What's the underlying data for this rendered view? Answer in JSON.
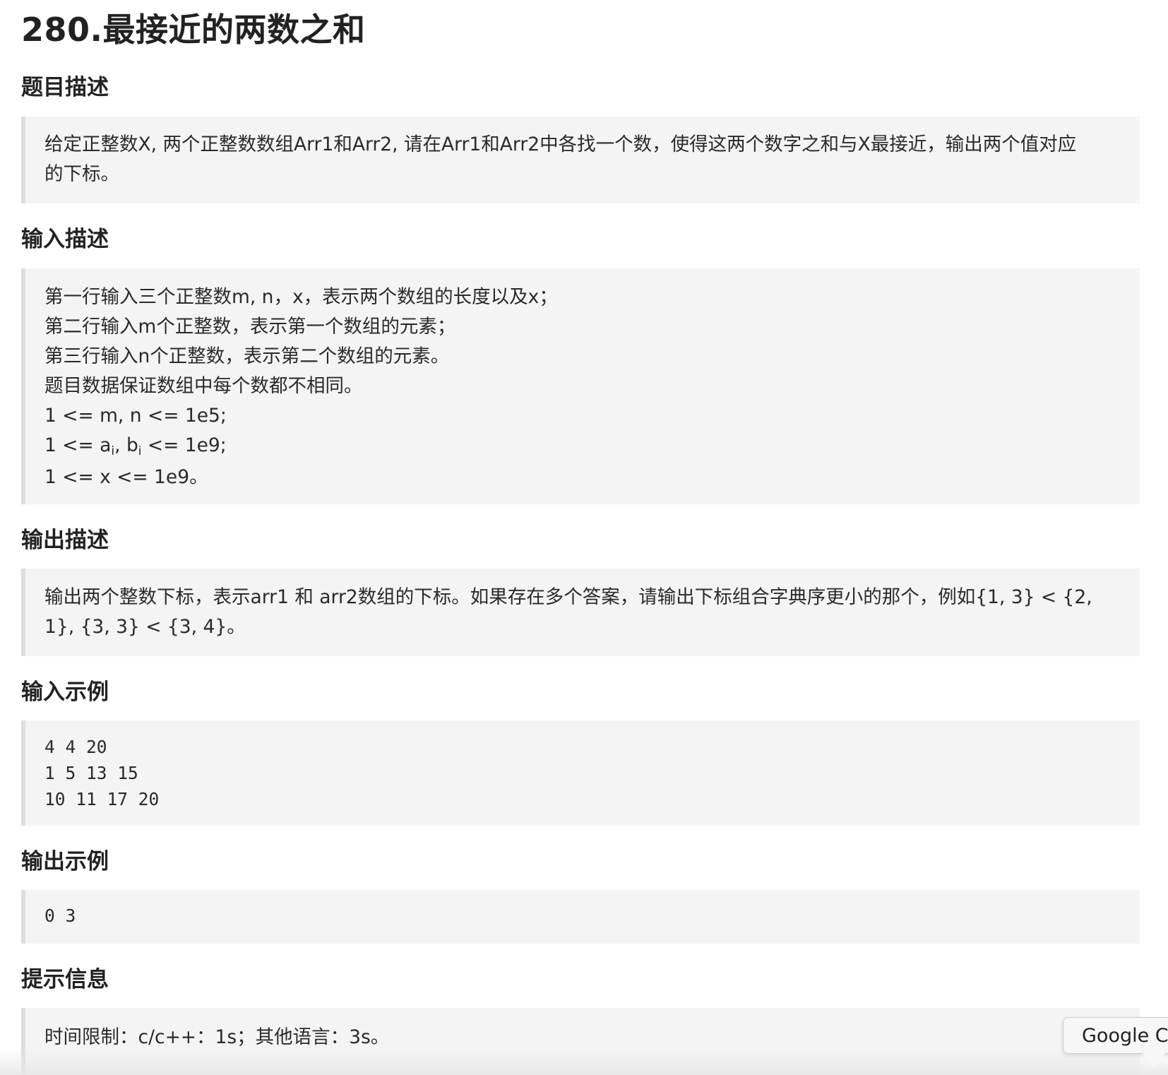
{
  "title": "280.最接近的两数之和",
  "sections": {
    "description": {
      "heading": "题目描述",
      "lines": [
        "给定正整数X, 两个正整数数组Arr1和Arr2, 请在Arr1和Arr2中各找一个数，使得这两个数字之和与X最接近，输出两个值对应",
        "的下标。"
      ]
    },
    "input_desc": {
      "heading": "输入描述",
      "lines": [
        "第一行输入三个正整数m, n，x，表示两个数组的长度以及x；",
        "第二行输入m个正整数，表示第一个数组的元素；",
        "第三行输入n个正整数，表示第二个数组的元素。",
        "题目数据保证数组中每个数都不相同。",
        "1 <= m, n <= 1e5;"
      ],
      "constraint_ab": {
        "prefix": "1 <= a",
        "sub_a": "i",
        "middle": ", b",
        "sub_b": "i",
        "suffix": " <= 1e9;"
      },
      "last_line": "1 <= x <= 1e9。"
    },
    "output_desc": {
      "heading": "输出描述",
      "lines": [
        "输出两个整数下标，表示arr1 和 arr2数组的下标。如果存在多个答案，请输出下标组合字典序更小的那个，例如{1, 3} < {2,",
        "1}, {3, 3} < {3, 4}。"
      ]
    },
    "input_example": {
      "heading": "输入示例",
      "lines": [
        "4 4 20",
        "1 5 13 15",
        "10 11 17 20"
      ]
    },
    "output_example": {
      "heading": "输出示例",
      "lines": [
        "0 3"
      ]
    },
    "hint": {
      "heading": "提示信息",
      "lines": [
        "时间限制：c/c++：1s；其他语言：3s。"
      ]
    }
  },
  "tooltip": {
    "label": "Google C"
  }
}
